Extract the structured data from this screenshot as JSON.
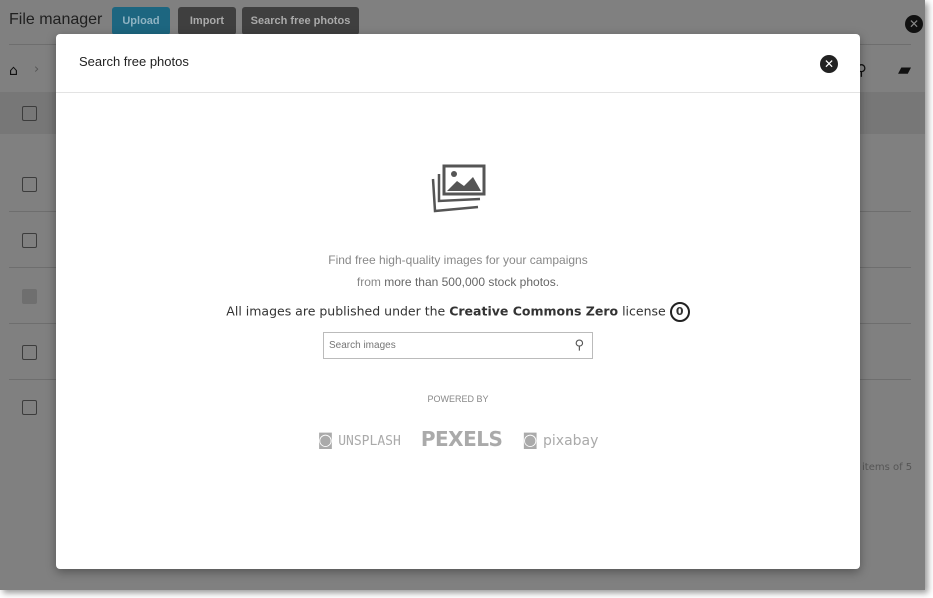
{
  "app": {
    "title": "File manager",
    "buttons": {
      "upload": "Upload",
      "import": "Import",
      "search_photos": "Search free photos"
    },
    "breadcrumb_sep": "›",
    "items_text": "items of 5"
  },
  "modal": {
    "title": "Search free photos",
    "line1": "Find free high-quality images for your campaigns",
    "line2_pre": "from ",
    "line2_bold": "more than 500,000 stock photos",
    "line2_post": ".",
    "license_pre": "All images are published under the ",
    "license_bold": "Creative Commons Zero",
    "license_post": " license",
    "cc_glyph": "0",
    "search_placeholder": "Search images",
    "powered_by": "POWERED BY",
    "providers": [
      "UNSPLASH",
      "PEXELS",
      "pixabay"
    ]
  },
  "colors": {
    "upload_button": "#1d6680",
    "overlay": "#808080"
  }
}
